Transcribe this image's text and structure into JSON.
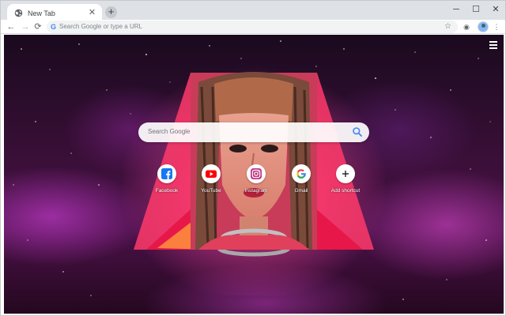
{
  "tabs": [
    {
      "title": "New Tab",
      "icon": "globe-icon"
    }
  ],
  "window_controls": {
    "minimize": "─",
    "maximize": "☐",
    "close": "✕"
  },
  "toolbar": {
    "back": "←",
    "forward": "→",
    "reload": "⟳",
    "omnibox_placeholder": "Search Google or type a URL"
  },
  "search": {
    "placeholder": "Search Google"
  },
  "shortcuts": [
    {
      "label": "Facebook",
      "icon": "facebook-icon",
      "color": "#1877f2"
    },
    {
      "label": "YouTube",
      "icon": "youtube-icon",
      "color": "#ff0000"
    },
    {
      "label": "Instagram",
      "icon": "instagram-icon",
      "color": "#c13584"
    },
    {
      "label": "Gmail",
      "icon": "google-icon",
      "color": "#4285f4"
    },
    {
      "label": "Add shortcut",
      "icon": "plus-icon",
      "color": "#202124"
    }
  ],
  "colors": {
    "accent": "#4285f4",
    "background_glow": "#ff2d8c"
  }
}
